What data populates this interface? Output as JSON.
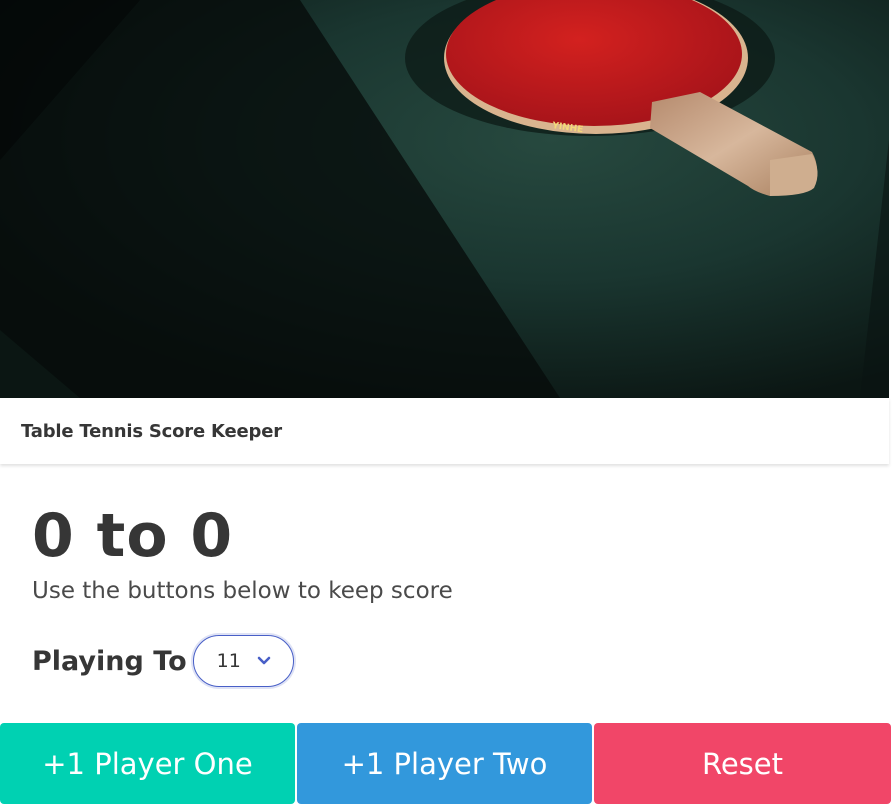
{
  "hero": {
    "image_description_icon": "table-tennis-paddle-photo",
    "paddle_brand_text": "YINHE"
  },
  "header": {
    "title": "Table Tennis Score Keeper"
  },
  "scoreboard": {
    "score_text": "0 to 0",
    "subtitle": "Use the buttons below to keep score"
  },
  "playing_to": {
    "label": "Playing To",
    "selected_value": "11",
    "icon": "chevron-down-icon"
  },
  "buttons": {
    "player_one": "+1 Player One",
    "player_two": "+1 Player Two",
    "reset": "Reset"
  },
  "colors": {
    "player_one": "#00d1b2",
    "player_two": "#3298dc",
    "reset": "#f14668",
    "select_border": "#485fc7",
    "paddle_red": "#c41a1f"
  }
}
